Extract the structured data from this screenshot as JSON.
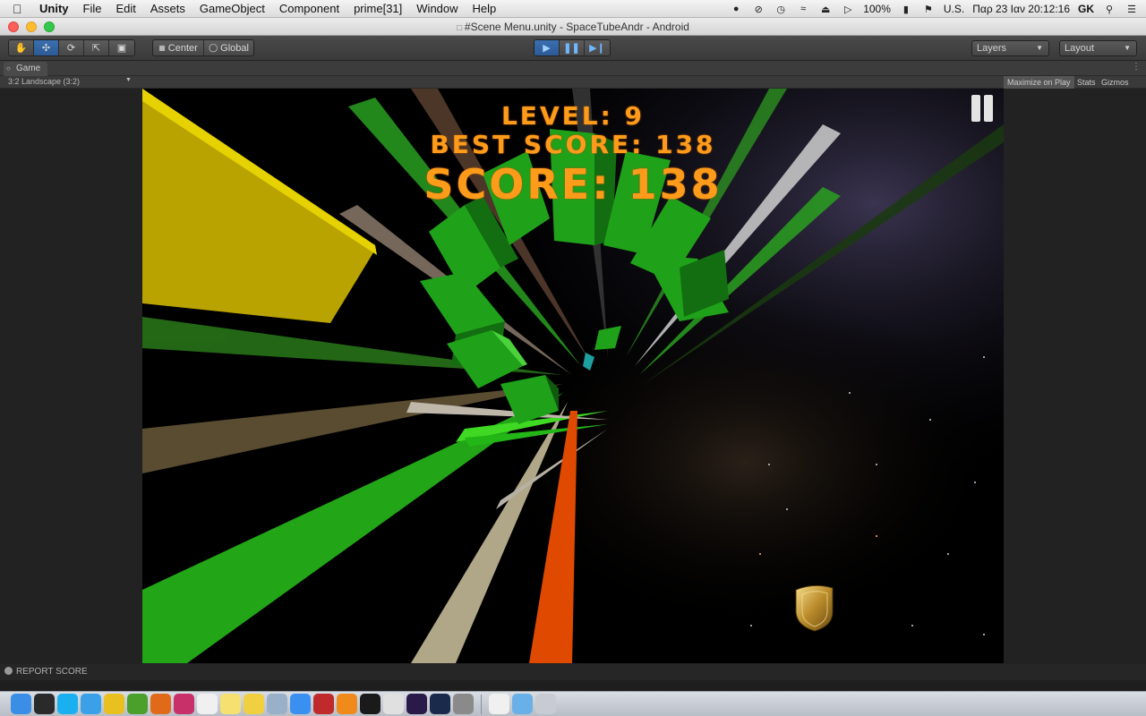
{
  "menubar": {
    "app": "Unity",
    "items": [
      "File",
      "Edit",
      "Assets",
      "GameObject",
      "Component",
      "prime[31]",
      "Window",
      "Help"
    ],
    "battery": "100%",
    "input_source": "U.S.",
    "datetime": "Παρ 23 Ιαν  20:12:16",
    "user": "GK"
  },
  "window": {
    "title": "#Scene Menu.unity - SpaceTubeAndr - Android"
  },
  "toolbar": {
    "pivot": "Center",
    "space": "Global",
    "layers": "Layers",
    "layout": "Layout"
  },
  "game_view": {
    "tab": "Game",
    "aspect": "3:2 Landscape (3:2)",
    "maximize": "Maximize on Play",
    "stats": "Stats",
    "gizmos": "Gizmos"
  },
  "hud": {
    "level": "LEVEL: 9",
    "best_score": "BEST SCORE: 138",
    "score": "SCORE: 138"
  },
  "status": {
    "message": "REPORT SCORE"
  },
  "colors": {
    "hud_orange": "#ff9b1a",
    "cube_green": "#1fa21a",
    "yellow_block": "#c9b400",
    "track_orange": "#e04a00"
  },
  "dock_icons": [
    "finder",
    "dashboard",
    "skype",
    "safari",
    "chrome",
    "utorrent",
    "firefox",
    "itunes",
    "calendar",
    "notes",
    "stickies",
    "launchpad",
    "appstore",
    "photo",
    "vlc",
    "terminal",
    "unity",
    "illustrator",
    "photoshop",
    "system-prefs",
    "documents",
    "downloads",
    "trash"
  ]
}
